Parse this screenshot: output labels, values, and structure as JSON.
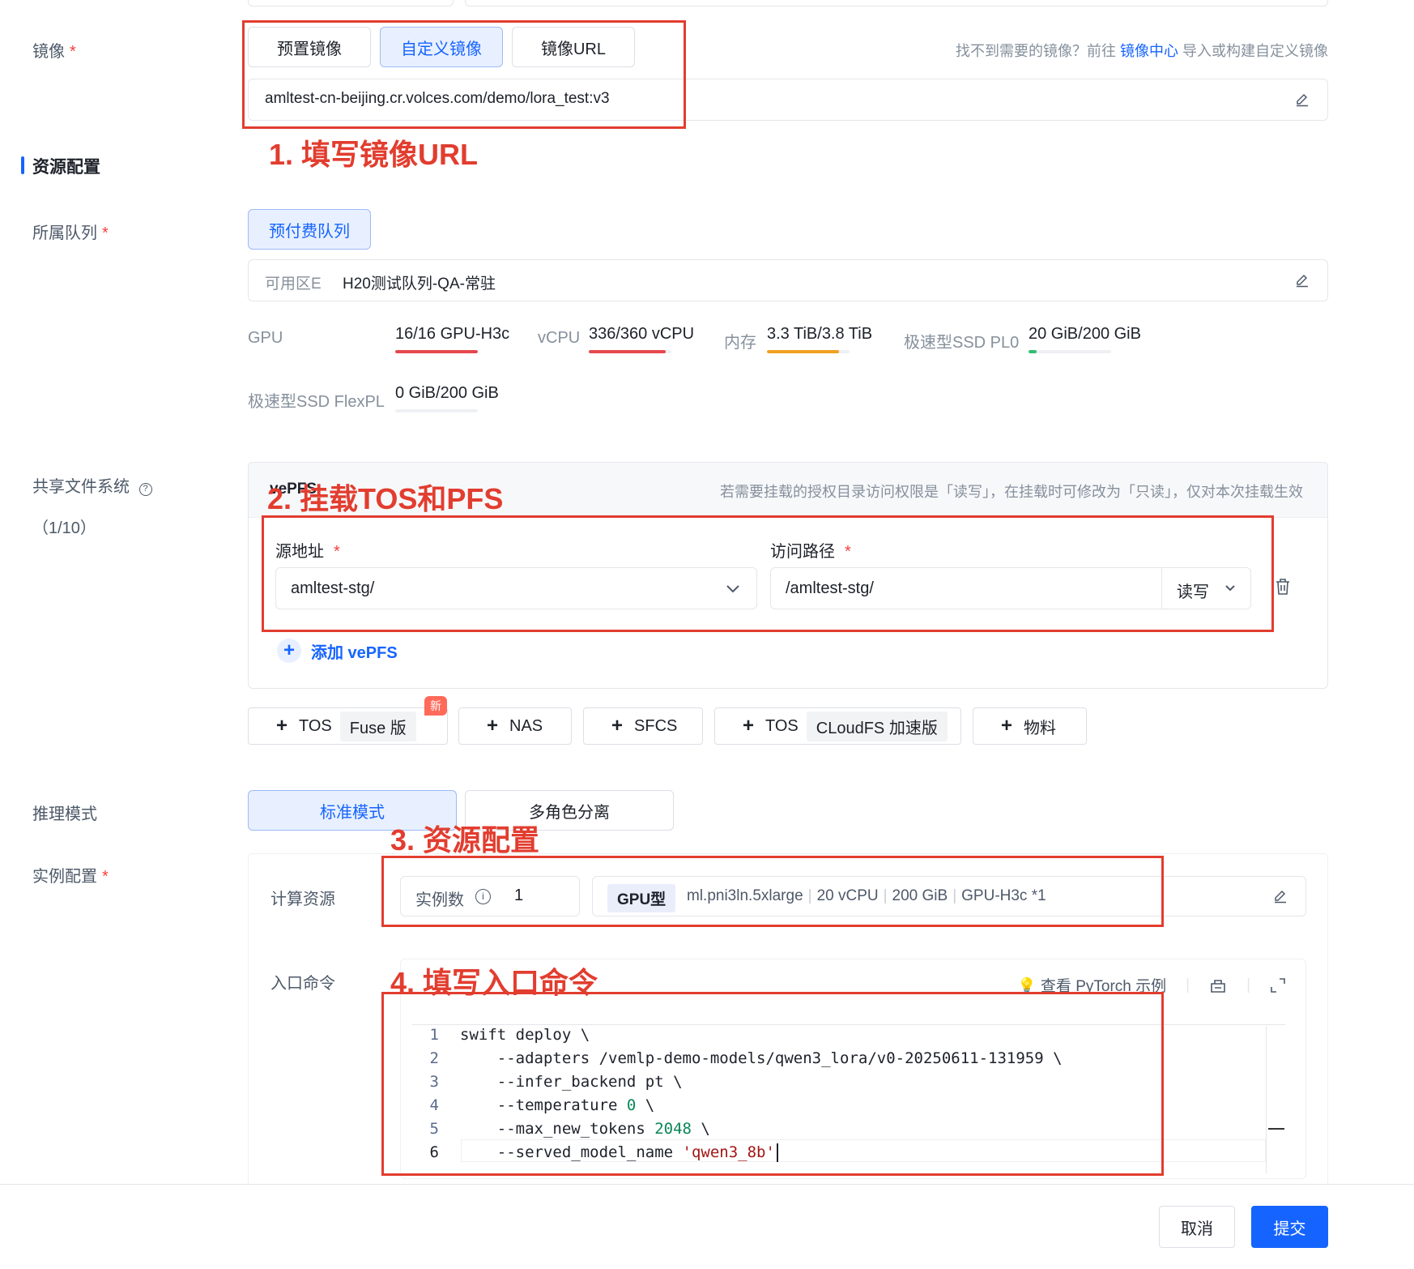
{
  "image_section": {
    "label": "镜像",
    "tabs": [
      "预置镜像",
      "自定义镜像",
      "镜像URL"
    ],
    "active_tab": "自定义镜像",
    "hint_prefix": "找不到需要的镜像？前往",
    "hint_link": "镜像中心",
    "hint_suffix": "导入或构建自定义镜像",
    "url_value": "amltest-cn-beijing.cr.volces.com/demo/lora_test:v3"
  },
  "resource_section": {
    "title": "资源配置",
    "queue_label": "所属队列",
    "queue_tab": "预付费队列",
    "zone_label": "可用区E",
    "queue_value": "H20测试队列-QA-常驻",
    "stats": [
      {
        "key": "GPU",
        "value": "16/16 GPU-H3c",
        "usage": 1.0,
        "color": "#e5484d"
      },
      {
        "key": "vCPU",
        "value": "336/360 vCPU",
        "usage": 0.93,
        "color": "#e5484d"
      },
      {
        "key": "内存",
        "value": "3.3 TiB/3.8 TiB",
        "usage": 0.87,
        "color": "#f0a020"
      },
      {
        "key": "极速型SSD PL0",
        "value": "20 GiB/200 GiB",
        "usage": 0.1,
        "color": "#2fbf71"
      },
      {
        "key": "极速型SSD FlexPL",
        "value": "0 GiB/200 GiB",
        "usage": 0.0,
        "color": "#2fbf71"
      }
    ]
  },
  "fs_section": {
    "label": "共享文件系统",
    "count": "（1/10）",
    "panel_title": "vePFS",
    "panel_hint": "若需要挂载的授权目录访问权限是「读写」，在挂载时可修改为「只读」，仅对本次挂载生效",
    "source_label": "源地址",
    "source_value": "amltest-stg/",
    "path_label": "访问路径",
    "path_value": "/amltest-stg/",
    "perm_value": "读写",
    "add_label": "添加 vePFS",
    "add_buttons": {
      "tos": "TOS",
      "tos_chip": "Fuse 版",
      "new_badge": "新",
      "nas": "NAS",
      "sfcs": "SFCS",
      "tos2": "TOS",
      "tos2_chip": "CLoudFS 加速版",
      "material": "物料"
    }
  },
  "infer_section": {
    "label": "推理模式",
    "modes": [
      "标准模式",
      "多角色分离"
    ],
    "active_mode": "标准模式"
  },
  "instance_section": {
    "label": "实例配置",
    "compute_label": "计算资源",
    "instances_label": "实例数",
    "instances_value": "1",
    "gpu_chip": "GPU型",
    "spec": [
      "ml.pni3ln.5xlarge",
      "20 vCPU",
      "200 GiB",
      "GPU-H3c *1"
    ],
    "entry_label": "入口命令",
    "pytorch_link": "查看 PyTorch 示例",
    "code_lines": [
      "swift deploy \\",
      "    --adapters /vemlp-demo-models/qwen3_lora/v0-20250611-131959 \\",
      "    --infer_backend pt \\",
      "    --temperature 0 \\",
      "    --max_new_tokens 2048 \\",
      "    --served_model_name 'qwen3_8b'"
    ]
  },
  "annotations": [
    "1. 填写镜像URL",
    "2. 挂载TOS和PFS",
    "3. 资源配置",
    "4. 填写入口命令"
  ],
  "footer": {
    "cancel": "取消",
    "submit": "提交"
  },
  "colors": {
    "accent": "#1664ff",
    "annotation": "#e23d2f"
  }
}
